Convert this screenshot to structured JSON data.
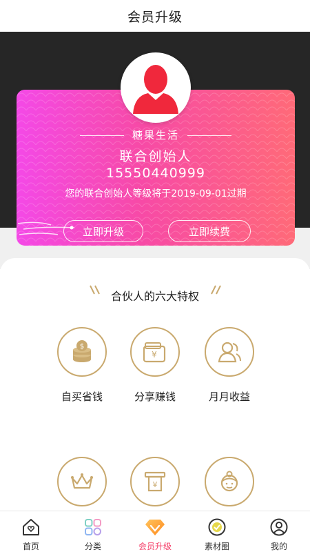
{
  "header": {
    "title": "会员升级"
  },
  "card": {
    "brand": "糖果生活",
    "level": "联合创始人",
    "phone": "15550440999",
    "expiry_notice": "您的联合创始人等级将于2019-09-01过期",
    "upgrade_label": "立即升级",
    "renew_label": "立即续费"
  },
  "privileges": {
    "title": "合伙人的六大特权",
    "items": [
      {
        "label": "自买省钱",
        "icon": "coins-icon"
      },
      {
        "label": "分享赚钱",
        "icon": "wallet-icon"
      },
      {
        "label": "月月收益",
        "icon": "users-icon"
      },
      {
        "label": "",
        "icon": "crown-icon"
      },
      {
        "label": "",
        "icon": "atm-icon"
      },
      {
        "label": "",
        "icon": "service-person-icon"
      }
    ]
  },
  "tabbar": {
    "items": [
      {
        "label": "首页",
        "icon": "home-icon",
        "active": false
      },
      {
        "label": "分类",
        "icon": "category-icon",
        "active": false
      },
      {
        "label": "会员升级",
        "icon": "diamond-icon",
        "active": true
      },
      {
        "label": "素材圈",
        "icon": "material-icon",
        "active": false
      },
      {
        "label": "我的",
        "icon": "profile-icon",
        "active": false
      }
    ]
  },
  "colors": {
    "accent": "#f5426b",
    "gold": "#c9a96e",
    "card_gradient": [
      "#f449e7",
      "#ff6a78"
    ]
  }
}
